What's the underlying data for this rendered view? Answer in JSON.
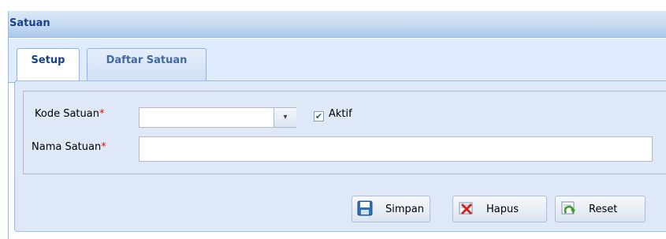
{
  "panel": {
    "title": "Satuan"
  },
  "tabs": [
    {
      "label": "Setup",
      "active": true
    },
    {
      "label": "Daftar Satuan",
      "active": false
    }
  ],
  "form": {
    "kode_label": "Kode Satuan",
    "kode_value": "",
    "nama_label": "Nama Satuan",
    "nama_value": "",
    "required_mark": "*",
    "aktif_label": "Aktif",
    "aktif_checked": true,
    "check_glyph": "✔",
    "dropdown_glyph": "▾"
  },
  "buttons": {
    "simpan": "Simpan",
    "hapus": "Hapus",
    "reset": "Reset"
  },
  "colors": {
    "accent": "#15428b",
    "border": "#99bbe8",
    "body_bg": "#dfe8f6",
    "required": "#ff0000"
  }
}
